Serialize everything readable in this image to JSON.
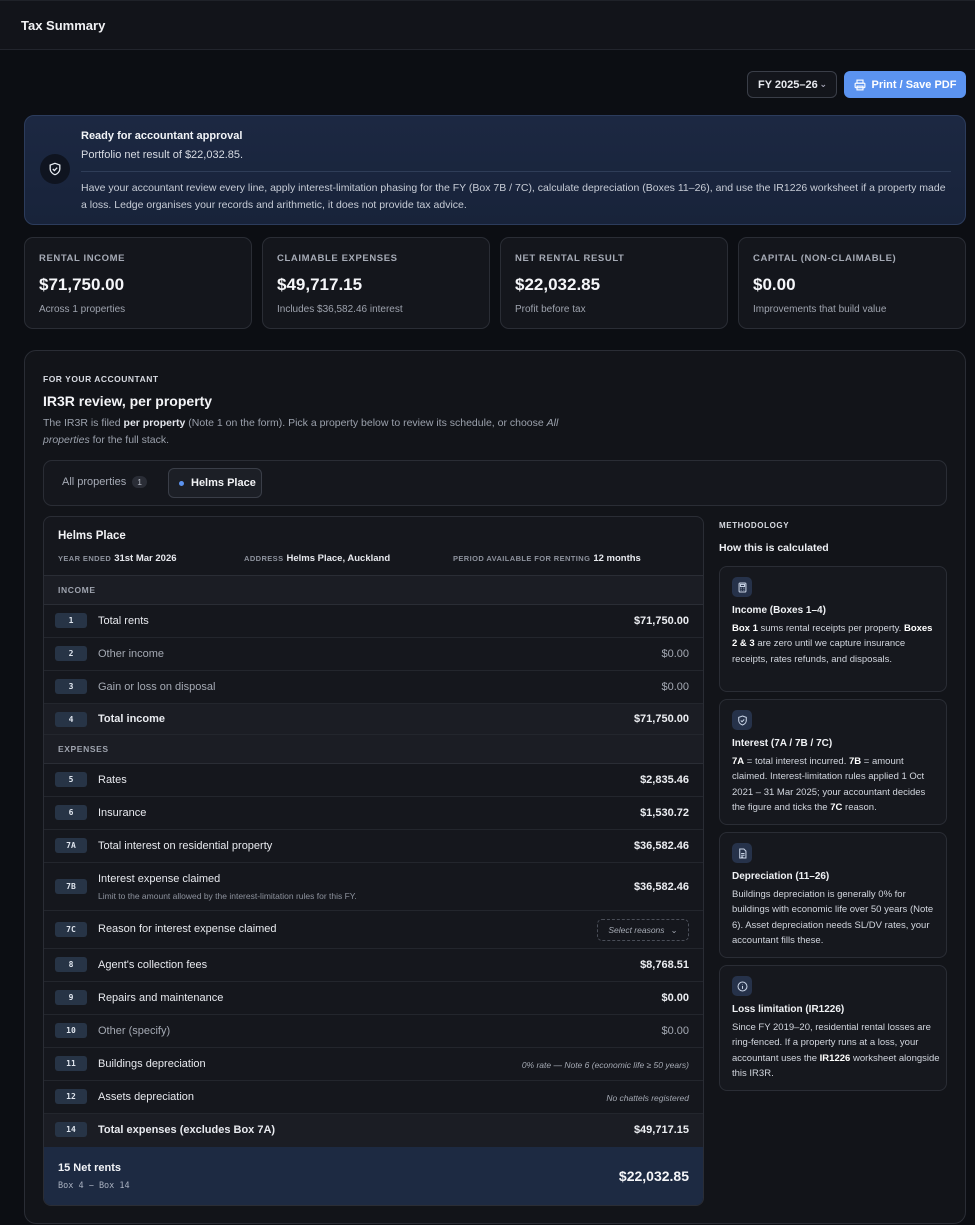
{
  "header": {
    "title": "Tax Summary"
  },
  "toolbar": {
    "fy_selected": "FY 2025–26",
    "print_label": "Print / Save PDF"
  },
  "banner": {
    "title": "Ready for accountant approval",
    "subtitle": "Portfolio net result of $22,032.85.",
    "body": "Have your accountant review every line, apply interest-limitation phasing for the FY (Box 7B / 7C), calculate depreciation (Boxes 11–26), and use the IR1226 worksheet if a property made a loss. Ledge organises your records and arithmetic, it does not provide tax advice."
  },
  "stats": [
    {
      "label": "RENTAL INCOME",
      "value": "$71,750.00",
      "note": "Across 1 properties"
    },
    {
      "label": "CLAIMABLE EXPENSES",
      "value": "$49,717.15",
      "note": "Includes $36,582.46 interest"
    },
    {
      "label": "NET RENTAL RESULT",
      "value": "$22,032.85",
      "note": "Profit before tax"
    },
    {
      "label": "CAPITAL (NON-CLAIMABLE)",
      "value": "$0.00",
      "note": "Improvements that build value"
    }
  ],
  "panel": {
    "kicker": "FOR YOUR ACCOUNTANT",
    "title": "IR3R review, per property",
    "desc_1": "The IR3R is filed ",
    "desc_bold": "per property",
    "desc_2": " (Note 1 on the form). Pick a property below to review its schedule, or choose ",
    "desc_italic": "All properties",
    "desc_3": " for the full stack."
  },
  "tabs": {
    "all_label": "All properties",
    "all_count": "1",
    "active_label": "Helms Place"
  },
  "schedule": {
    "name": "Helms Place",
    "year_key": "YEAR ENDED",
    "year_val": "31st Mar 2026",
    "address_key": "ADDRESS",
    "address_val": "Helms Place, Auckland",
    "period_key": "PERIOD AVAILABLE FOR RENTING",
    "period_val": "12 months",
    "income_header": "INCOME",
    "expenses_header": "EXPENSES",
    "rows": {
      "r1": {
        "box": "1",
        "label": "Total rents",
        "amount": "$71,750.00"
      },
      "r2": {
        "box": "2",
        "label": "Other income",
        "amount": "$0.00"
      },
      "r3": {
        "box": "3",
        "label": "Gain or loss on disposal",
        "amount": "$0.00"
      },
      "r4": {
        "box": "4",
        "label": "Total income",
        "amount": "$71,750.00"
      },
      "r5": {
        "box": "5",
        "label": "Rates",
        "amount": "$2,835.46"
      },
      "r6": {
        "box": "6",
        "label": "Insurance",
        "amount": "$1,530.72"
      },
      "r7a": {
        "box": "7A",
        "label": "Total interest on residential property",
        "amount": "$36,582.46"
      },
      "r7b": {
        "box": "7B",
        "label": "Interest expense claimed",
        "sublabel": "Limit to the amount allowed by the interest-limitation rules for this FY.",
        "amount": "$36,582.46"
      },
      "r7c": {
        "box": "7C",
        "label": "Reason for interest expense claimed",
        "select": "Select reasons"
      },
      "r8": {
        "box": "8",
        "label": "Agent's collection fees",
        "amount": "$8,768.51"
      },
      "r9": {
        "box": "9",
        "label": "Repairs and maintenance",
        "amount": "$0.00"
      },
      "r10": {
        "box": "10",
        "label": "Other (specify)",
        "amount": "$0.00"
      },
      "r11": {
        "box": "11",
        "label": "Buildings depreciation",
        "note": "0% rate — Note 6 (economic life ≥ 50 years)"
      },
      "r12": {
        "box": "12",
        "label": "Assets depreciation",
        "note": "No chattels registered"
      },
      "r14": {
        "box": "14",
        "label": "Total expenses (excludes Box 7A)",
        "amount": "$49,717.15"
      }
    },
    "net": {
      "title": "15 Net rents",
      "formula": "Box 4 − Box 14",
      "value": "$22,032.85"
    }
  },
  "methodology": {
    "kicker": "METHODOLOGY",
    "title": "How this is calculated",
    "cards": [
      {
        "icon": "calculator-icon",
        "title": "Income (Boxes 1–4)"
      },
      {
        "icon": "shield-icon",
        "title": "Interest (7A / 7B / 7C)"
      },
      {
        "icon": "document-icon",
        "title": "Depreciation (11–26)",
        "body": "Buildings depreciation is generally 0% for buildings with economic life over 50 years (Note 6). Asset depreciation needs SL/DV rates, your accountant fills these."
      },
      {
        "icon": "info-icon",
        "title": "Loss limitation (IR1226)"
      }
    ],
    "income_b1": "Box 1",
    "income_t1": " sums rental receipts per property. ",
    "income_b2": "Boxes 2 & 3",
    "income_t2": " are zero until we capture insurance receipts, rates refunds, and disposals.",
    "interest_b1": "7A",
    "interest_t1": " = total interest incurred. ",
    "interest_b2": "7B",
    "interest_t2": " = amount claimed. Interest-limitation rules applied 1 Oct 2021 – 31 Mar 2025; your accountant decides the figure and ticks the ",
    "interest_b3": "7C",
    "interest_t3": " reason.",
    "loss_t1": "Since FY 2019–20, residential rental losses are ring-fenced. If a property runs at a loss, your accountant uses the ",
    "loss_b1": "IR1226",
    "loss_t2": " worksheet alongside this IR3R."
  }
}
